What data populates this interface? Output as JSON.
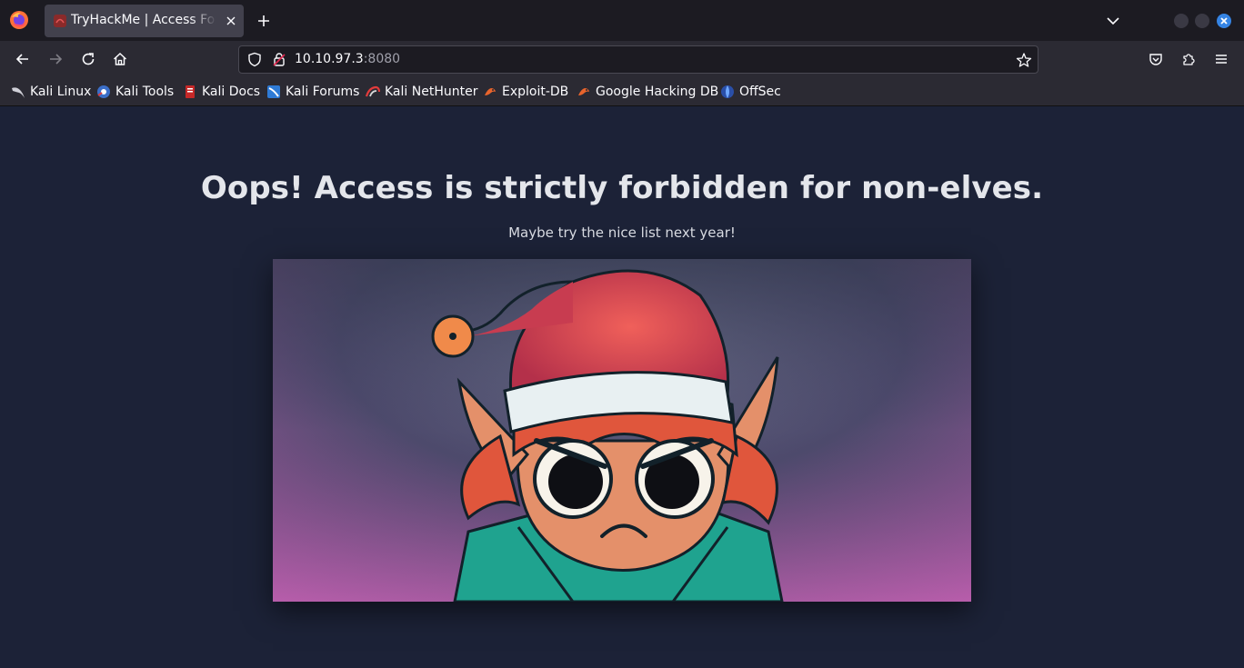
{
  "browser": {
    "tab": {
      "title": "TryHackMe | Access Forbidden"
    },
    "url": {
      "host": "10.10.97.3",
      "port": ":8080"
    }
  },
  "bookmarks": [
    {
      "label": "Kali Linux",
      "icon": "kali-dragon-icon"
    },
    {
      "label": "Kali Tools",
      "icon": "kali-tools-icon"
    },
    {
      "label": "Kali Docs",
      "icon": "kali-docs-icon"
    },
    {
      "label": "Kali Forums",
      "icon": "kali-forums-icon"
    },
    {
      "label": "Kali NetHunter",
      "icon": "kali-nethunter-icon"
    },
    {
      "label": "Exploit-DB",
      "icon": "exploit-db-icon"
    },
    {
      "label": "Google Hacking DB",
      "icon": "ghdb-icon"
    },
    {
      "label": "OffSec",
      "icon": "offsec-icon"
    }
  ],
  "page": {
    "title": "Oops! Access is strictly forbidden for non-elves.",
    "subtitle": "Maybe try the nice list next year!",
    "image_subject": "grumpy-elf-illustration"
  },
  "colors": {
    "page_bg": "#1c2237",
    "tab_bar_bg": "#1c1b22",
    "toolbar_bg": "#2b2a33",
    "active_tab_bg": "#42414d",
    "close_accent": "#3584e4"
  }
}
